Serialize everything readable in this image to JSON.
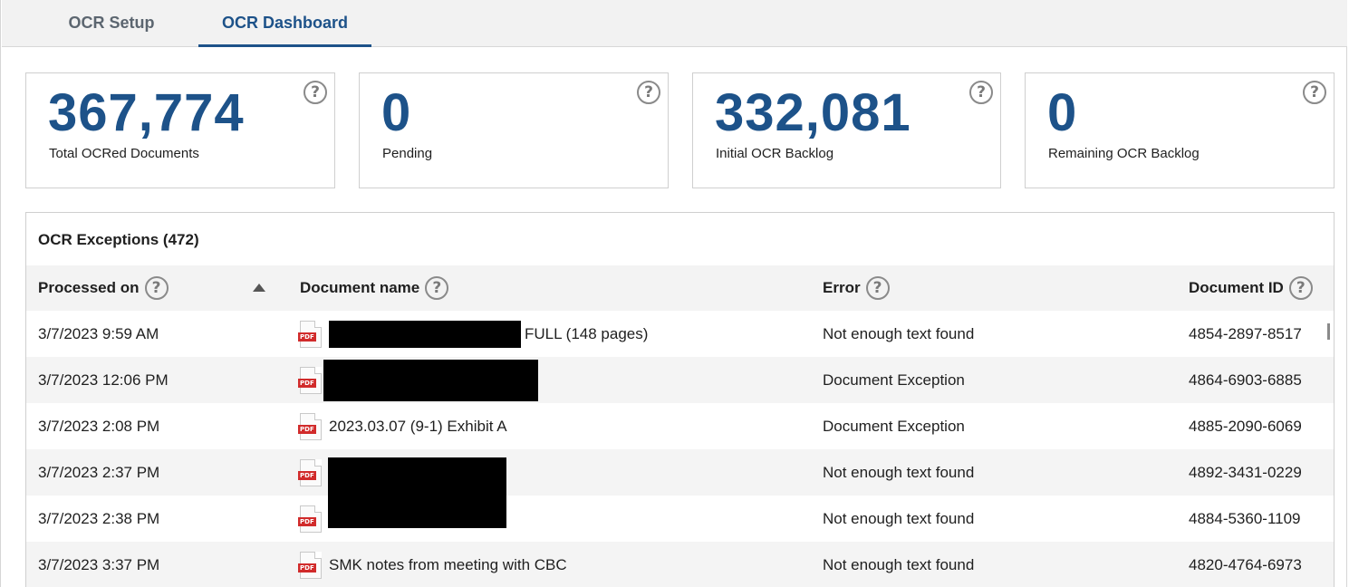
{
  "tabs": [
    {
      "label": "OCR Setup",
      "active": false
    },
    {
      "label": "OCR Dashboard",
      "active": true
    }
  ],
  "metrics": [
    {
      "value": "367,774",
      "label": "Total OCRed Documents"
    },
    {
      "value": "0",
      "label": "Pending"
    },
    {
      "value": "332,081",
      "label": "Initial OCR Backlog"
    },
    {
      "value": "0",
      "label": "Remaining OCR Backlog"
    }
  ],
  "help_glyph": "?",
  "exceptions": {
    "title": "OCR Exceptions (472)",
    "columns": [
      "Processed on",
      "Document name",
      "Error",
      "Document ID"
    ],
    "sort": {
      "column": "Processed on",
      "direction": "ascending"
    },
    "file_icon": {
      "icon": "pdf-icon",
      "label": "PDF",
      "color": "#d12b2b"
    },
    "rows": [
      {
        "processed_on": "3/7/2023 9:59 AM",
        "document_name": "FULL (148 pages)",
        "error": "Not enough text found",
        "document_id": "4854-2897-8517"
      },
      {
        "processed_on": "3/7/2023 12:06 PM",
        "document_name": "",
        "error": "Document Exception",
        "document_id": "4864-6903-6885"
      },
      {
        "processed_on": "3/7/2023 2:08 PM",
        "document_name": "2023.03.07 (9-1) Exhibit A",
        "error": "Document Exception",
        "document_id": "4885-2090-6069"
      },
      {
        "processed_on": "3/7/2023 2:37 PM",
        "document_name": "",
        "error": "Not enough text found",
        "document_id": "4892-3431-0229"
      },
      {
        "processed_on": "3/7/2023 2:38 PM",
        "document_name": "",
        "error": "Not enough text found",
        "document_id": "4884-5360-1109"
      },
      {
        "processed_on": "3/7/2023 3:37 PM",
        "document_name": "SMK notes from meeting with CBC",
        "error": "Not enough text found",
        "document_id": "4820-4764-6973"
      }
    ]
  },
  "colors": {
    "accent": "#1d5289",
    "row_alt": "#f4f4f4",
    "header_bg": "#f3f3f3",
    "redaction": "#000000"
  }
}
